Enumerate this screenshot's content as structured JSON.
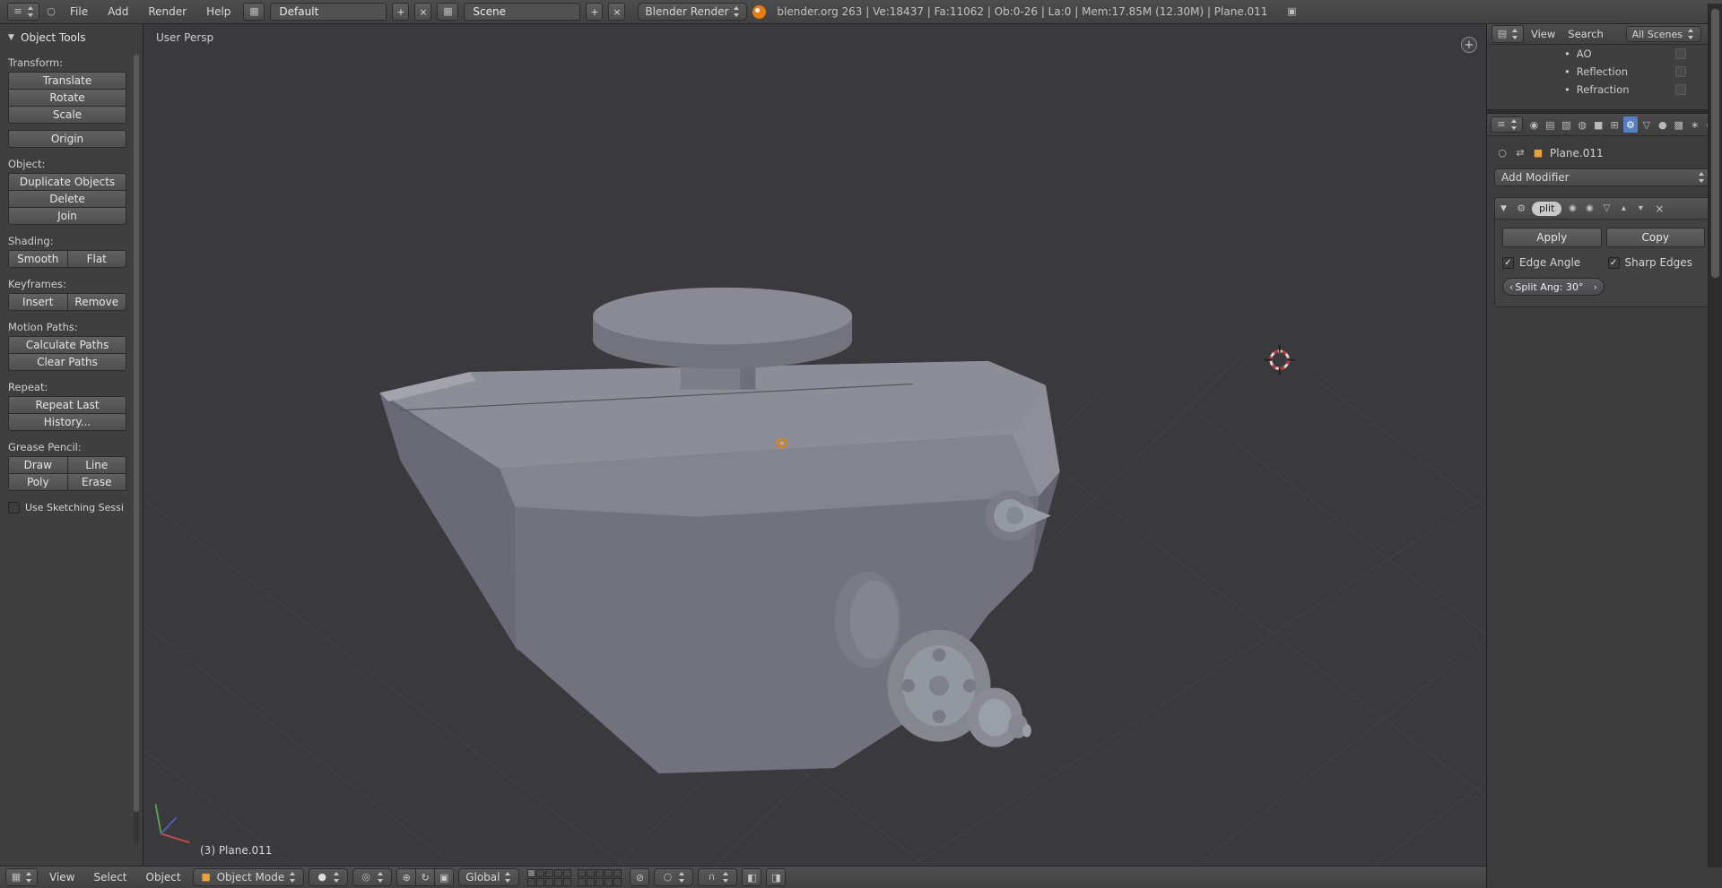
{
  "colors": {
    "accent_selected": "#5680c2",
    "object_orange": "#e8a33d",
    "origin_orange": "#e87d0d",
    "cursor_red": "#c03535",
    "viewport_bg": "#3a3a3e"
  },
  "top_header": {
    "menus": [
      "File",
      "Add",
      "Render",
      "Help"
    ],
    "layout_field": "Default",
    "scene_field": "Scene",
    "engine_select": "Blender Render",
    "info_text": "blender.org 263 | Ve:18437 | Fa:11062 | Ob:0-26 | La:0 | Mem:17.85M (12.30M) | Plane.011"
  },
  "tool_shelf": {
    "title": "Object Tools",
    "transform": {
      "label": "Transform:",
      "translate": "Translate",
      "rotate": "Rotate",
      "scale": "Scale",
      "origin": "Origin"
    },
    "object": {
      "label": "Object:",
      "duplicate": "Duplicate Objects",
      "delete": "Delete",
      "join": "Join"
    },
    "shading": {
      "label": "Shading:",
      "smooth": "Smooth",
      "flat": "Flat"
    },
    "keyframes": {
      "label": "Keyframes:",
      "insert": "Insert",
      "remove": "Remove"
    },
    "motion_paths": {
      "label": "Motion Paths:",
      "calculate": "Calculate Paths",
      "clear": "Clear Paths"
    },
    "repeat": {
      "label": "Repeat:",
      "repeat_last": "Repeat Last",
      "history": "History..."
    },
    "grease_pencil": {
      "label": "Grease Pencil:",
      "draw": "Draw",
      "line": "Line",
      "poly": "Poly",
      "erase": "Erase"
    },
    "use_sketching": "Use Sketching Sessi"
  },
  "viewport": {
    "view_label": "User Persp",
    "active_object": "(3) Plane.011"
  },
  "view3d_header": {
    "menus": [
      "View",
      "Select",
      "Object"
    ],
    "mode_select": "Object Mode",
    "orientation_select": "Global"
  },
  "outliner": {
    "menus": [
      "View",
      "Search"
    ],
    "display_filter": "All Scenes",
    "items": [
      {
        "label": "AO"
      },
      {
        "label": "Reflection"
      },
      {
        "label": "Refraction"
      }
    ]
  },
  "properties": {
    "breadcrumb_object": "Plane.011",
    "add_modifier": "Add Modifier",
    "modifier": {
      "name": "plit",
      "apply": "Apply",
      "copy": "Copy",
      "edge_angle": "Edge Angle",
      "sharp_edges": "Sharp Edges",
      "split_angle": "Split Ang: 30°"
    }
  },
  "glyphs": {
    "collapse_down": "▼",
    "plus": "+",
    "close": "×",
    "check": "✓",
    "bullet": "•",
    "editor_info": "≡",
    "editor_3d": "▦",
    "editor_outliner": "▤",
    "editor_props": "≡",
    "screen_layout": "▦",
    "scene_icon": "▦",
    "window_icon": "▣",
    "circle_outline": "○",
    "camera": "◉",
    "eye": "◉",
    "tab_render": "◉",
    "tab_scene": "▤",
    "tab_layers": "▧",
    "tab_world": "◍",
    "tab_object": "■",
    "tab_constraints": "⊞",
    "tab_modifiers": "⚙",
    "tab_data": "▽",
    "tab_material": "●",
    "tab_texture": "▩",
    "tab_particles": "∗",
    "tab_physics": "○",
    "pin": "○",
    "arrows_lr": "⇄",
    "up_small": "▴",
    "down_small": "▾",
    "left_arrow": "‹",
    "right_arrow": "›",
    "mode_cube": "■",
    "shading_sphere": "●",
    "pivot": "◎",
    "manip_translate": "⊕",
    "manip_rotate": "↻",
    "manip_scale": "▣",
    "proportional": "○",
    "magnet": "∩",
    "lock": "⊘",
    "render_still": "◧",
    "render_anim": "◨",
    "wrench": "⚙"
  }
}
